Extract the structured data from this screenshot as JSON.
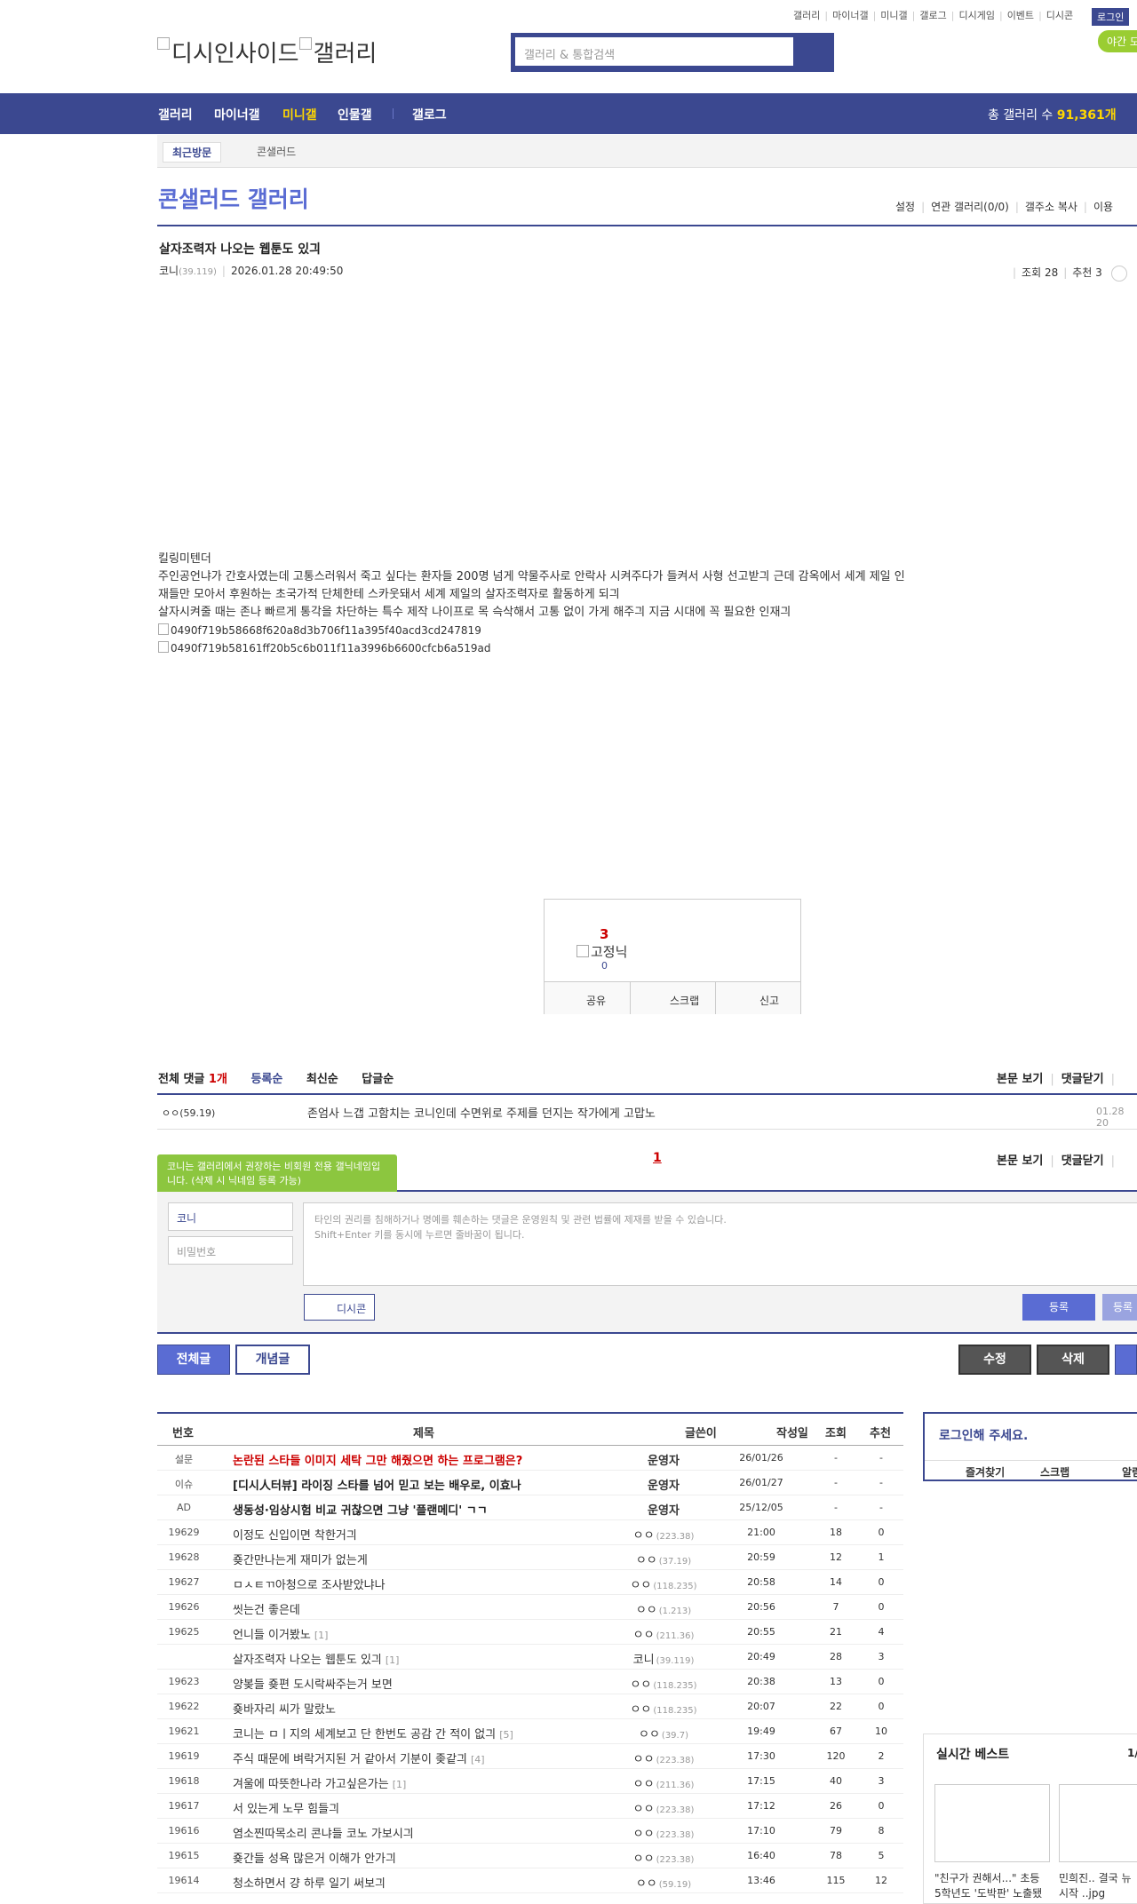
{
  "topnav": [
    "갤러리",
    "마이너갤",
    "미니갤",
    "갤로그",
    "디시게임",
    "이벤트",
    "디시콘"
  ],
  "login_label": "로그인",
  "night_label": "야간 모",
  "logo_text": "디시인사이드",
  "logo_text2": "갤러리",
  "search_placeholder": "갤러리 & 통합검색",
  "gnb": {
    "items": [
      "갤러리",
      "마이너갤",
      "미니갤",
      "인물갤",
      "갤로그"
    ],
    "total_label": "총 갤러리 수",
    "total_count": "91,361개"
  },
  "visit": {
    "recent": "최근방문",
    "item": "콘샐러드"
  },
  "gallery": {
    "title": "콘샐러드 갤러리",
    "menu": [
      "설정",
      "연관 갤러리(0/0)",
      "갤주소 복사",
      "이용"
    ]
  },
  "post": {
    "title": "살자조력자 나오는 웹툰도 있긔",
    "author": "코니",
    "ip": "(39.119)",
    "date": "2026.01.28 20:49:50",
    "views": "조회 28",
    "recommends": "추천 3",
    "body": [
      "킬링미텐더",
      "주인공언냐가 간호사였는데 고통스러워서 죽고 싶다는 환자들 200명 넘게 약물주사로 안락사 시켜주다가 들켜서 사형 선고받긔 근데 감옥에서 세계 제일 인",
      "재들만 모아서 후원하는 초국가적 단체한테 스카웃돼서 세계 제일의 살자조력자로 활동하게 되긔",
      "살자시켜줄 때는 존나 빠르게 통각을 차단하는 특수 제작 나이프로 목 슥삭해서 고통 없이 가게 해주긔 지금 시대에 꼭 필요한 인재긔"
    ],
    "images": [
      "0490f719b58668f620a8d3b706f11a395f40acd3cd247819",
      "0490f719b58161ff20b5c6b011f11a3996b6600cfcb6a519ad"
    ]
  },
  "recommend": {
    "count": "3",
    "fix_label": "고정닉",
    "fix_count": "0",
    "buttons": [
      "공유",
      "스크랩",
      "신고"
    ]
  },
  "comments": {
    "total_label": "전체 댓글",
    "total_count": "1개",
    "sorts": [
      "등록순",
      "최신순",
      "답글순"
    ],
    "view_body": "본문 보기",
    "close": "댓글닫기",
    "items": [
      {
        "nick": "ㅇㅇ(59.19)",
        "text": "존엄사 느갭 고함치는 코니인데 수면위로 주제를 던지는 작가에게 고맙노",
        "date": "01.28 20"
      }
    ],
    "page": "1",
    "tip": "코니는 갤러리에서 권장하는 비회원 전용 갤닉네임입니다. (삭제 시 닉네임 등록 가능)",
    "nick_value": "코니",
    "pw_placeholder": "비밀번호",
    "textarea_placeholder1": "타인의 권리를 침해하거나 명예를 훼손하는 댓글은 운영원칙 및 관련 법률에 제재를 받을 수 있습니다.",
    "textarea_placeholder2": "Shift+Enter 키를 동시에 누르면 줄바꿈이 됩니다.",
    "dccon": "디시콘",
    "submit": "등록",
    "submit2": "등록"
  },
  "list_buttons": {
    "all": "전체글",
    "concept": "개념글",
    "edit": "수정",
    "delete": "삭제"
  },
  "table": {
    "headers": [
      "번호",
      "제목",
      "글쓴이",
      "작성일",
      "조회",
      "추천"
    ],
    "rows": [
      {
        "no": "설문",
        "title": "논란된 스타들 이미지 세탁 그만 해줬으면 하는 프로그램은?",
        "cc": "",
        "writer": "운영자",
        "ip": "",
        "date": "26/01/26",
        "views": "-",
        "recs": "-",
        "style": "red",
        "op": true
      },
      {
        "no": "이슈",
        "title": "[디시人터뷰] 라이징 스타를 넘어 믿고 보는 배우로, 이효나",
        "cc": "",
        "writer": "운영자",
        "ip": "",
        "date": "26/01/27",
        "views": "-",
        "recs": "-",
        "style": "bold",
        "op": true
      },
      {
        "no": "AD",
        "title": "생동성·임상시험 비교 귀찮으면 그냥 '플랜메디' ㄱㄱ",
        "cc": "",
        "writer": "운영자",
        "ip": "",
        "date": "25/12/05",
        "views": "-",
        "recs": "-",
        "style": "bold",
        "op": true
      },
      {
        "no": "19629",
        "title": "이정도 신입이면 착한거긔",
        "cc": "",
        "writer": "ㅇㅇ",
        "ip": "(223.38)",
        "date": "21:00",
        "views": "18",
        "recs": "0",
        "style": "",
        "op": false
      },
      {
        "no": "19628",
        "title": "죶간만나는게 재미가 없는게",
        "cc": "",
        "writer": "ㅇㅇ",
        "ip": "(37.19)",
        "date": "20:59",
        "views": "12",
        "recs": "1",
        "style": "",
        "op": false
      },
      {
        "no": "19627",
        "title": "ㅁㅅㅌㄲ아청으로 조사받았냐나",
        "cc": "",
        "writer": "ㅇㅇ",
        "ip": "(118.235)",
        "date": "20:58",
        "views": "14",
        "recs": "0",
        "style": "",
        "op": false
      },
      {
        "no": "19626",
        "title": "씻는건 좋은데",
        "cc": "",
        "writer": "ㅇㅇ",
        "ip": "(1.213)",
        "date": "20:56",
        "views": "7",
        "recs": "0",
        "style": "",
        "op": false
      },
      {
        "no": "19625",
        "title": "언니들 이거봤노",
        "cc": "[1]",
        "writer": "ㅇㅇ",
        "ip": "(211.36)",
        "date": "20:55",
        "views": "21",
        "recs": "4",
        "style": "",
        "op": false
      },
      {
        "no": "",
        "title": "살자조력자 나오는 웹툰도 있긔",
        "cc": "[1]",
        "writer": "코니",
        "ip": "(39.119)",
        "date": "20:49",
        "views": "28",
        "recs": "3",
        "style": "",
        "op": false
      },
      {
        "no": "19623",
        "title": "양봊들 죶편 도시락싸주는거 보면",
        "cc": "",
        "writer": "ㅇㅇ",
        "ip": "(118.235)",
        "date": "20:38",
        "views": "13",
        "recs": "0",
        "style": "",
        "op": false
      },
      {
        "no": "19622",
        "title": "죶바자리 씨가 말랐노",
        "cc": "",
        "writer": "ㅇㅇ",
        "ip": "(118.235)",
        "date": "20:07",
        "views": "22",
        "recs": "0",
        "style": "",
        "op": false
      },
      {
        "no": "19621",
        "title": "코니는 ㅁㅣ지의 세계보고 단 한번도 공감 간 적이 없긔",
        "cc": "[5]",
        "writer": "ㅇㅇ",
        "ip": "(39.7)",
        "date": "19:49",
        "views": "67",
        "recs": "10",
        "style": "",
        "op": false
      },
      {
        "no": "19619",
        "title": "주식 때문에 벼락거지된 거 같아서 기분이 좆같긔",
        "cc": "[4]",
        "writer": "ㅇㅇ",
        "ip": "(223.38)",
        "date": "17:30",
        "views": "120",
        "recs": "2",
        "style": "",
        "op": false
      },
      {
        "no": "19618",
        "title": "겨울에 따뜻한나라 가고싶은가는",
        "cc": "[1]",
        "writer": "ㅇㅇ",
        "ip": "(211.36)",
        "date": "17:15",
        "views": "40",
        "recs": "3",
        "style": "",
        "op": false
      },
      {
        "no": "19617",
        "title": "서 있는게 노무 힘들긔",
        "cc": "",
        "writer": "ㅇㅇ",
        "ip": "(223.38)",
        "date": "17:12",
        "views": "26",
        "recs": "0",
        "style": "",
        "op": false
      },
      {
        "no": "19616",
        "title": "염소찐따목소리 콘냐들 코노 가보시긔",
        "cc": "",
        "writer": "ㅇㅇ",
        "ip": "(223.38)",
        "date": "17:10",
        "views": "79",
        "recs": "8",
        "style": "",
        "op": false
      },
      {
        "no": "19615",
        "title": "죶간들 성욕 많은거 이해가 안가긔",
        "cc": "",
        "writer": "ㅇㅇ",
        "ip": "(223.38)",
        "date": "16:40",
        "views": "78",
        "recs": "5",
        "style": "",
        "op": false
      },
      {
        "no": "19614",
        "title": "청소하면서 걍 하루 일기 써보긔",
        "cc": "",
        "writer": "ㅇㅇ",
        "ip": "(59.19)",
        "date": "13:46",
        "views": "115",
        "recs": "12",
        "style": "",
        "op": false
      }
    ]
  },
  "loginbox": {
    "title": "로그인해 주세요.",
    "links": [
      "즐겨찾기",
      "스크랩",
      "알림"
    ]
  },
  "best": {
    "title": "실시간 베스트",
    "page": "1/",
    "items": [
      {
        "cap1": "\"친구가 권해서...\" 초등",
        "cap2": "5학년도 '도박판' 노출됐"
      },
      {
        "cap1": "민희진.. 결국 뉴",
        "cap2": "시작 ..jpg"
      }
    ]
  }
}
